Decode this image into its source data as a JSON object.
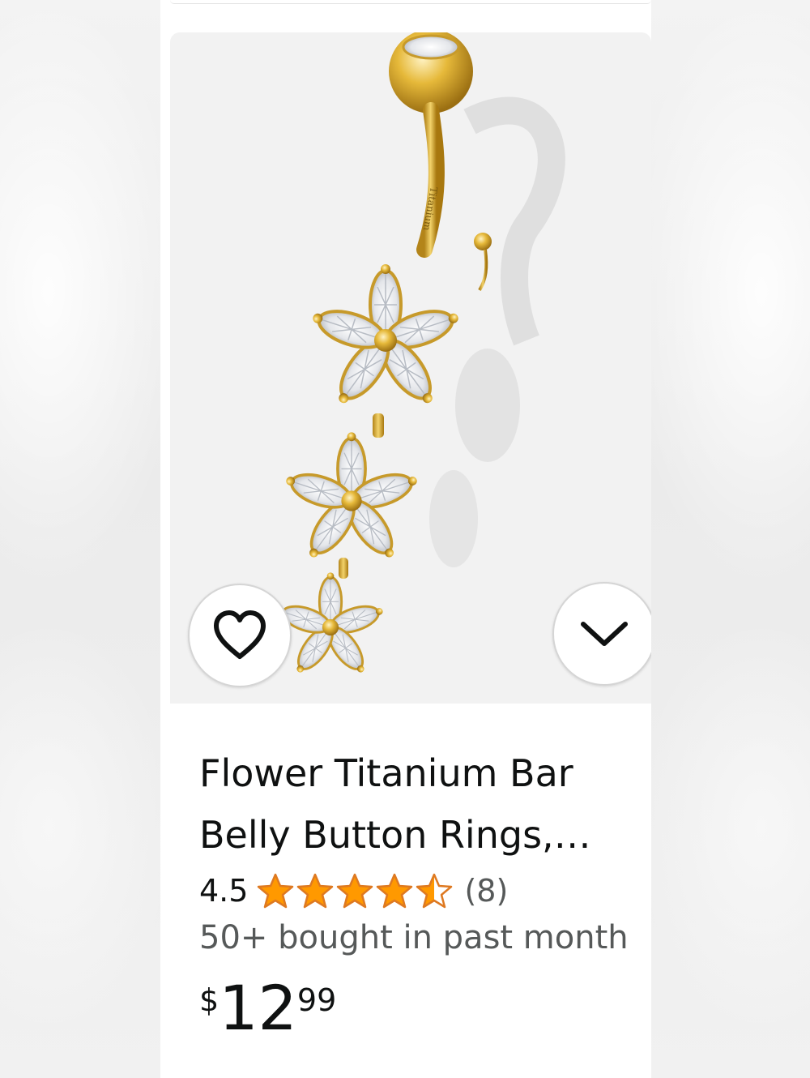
{
  "product": {
    "title": "Flower Titanium Bar Belly Button Rings, Surgical Steel Navel Piercing Jewelry",
    "rating_value": "4.5",
    "rating_stars": 4.5,
    "rating_max": 5,
    "review_count": "(8)",
    "bought_text": "50+ bought in past month",
    "price": {
      "symbol": "$",
      "whole": "12",
      "fraction": "99"
    },
    "bar_engraving": "Titanium"
  },
  "icons": {
    "wishlist": "heart-outline-icon",
    "more_options": "chevron-down-icon",
    "star": "star-icon"
  },
  "colors": {
    "star_fill": "#ff9900",
    "star_stroke": "#de7921",
    "gold": "#d9a92c",
    "text_primary": "#0f1111",
    "text_secondary": "#565959",
    "image_bg": "#f2f2f2"
  }
}
